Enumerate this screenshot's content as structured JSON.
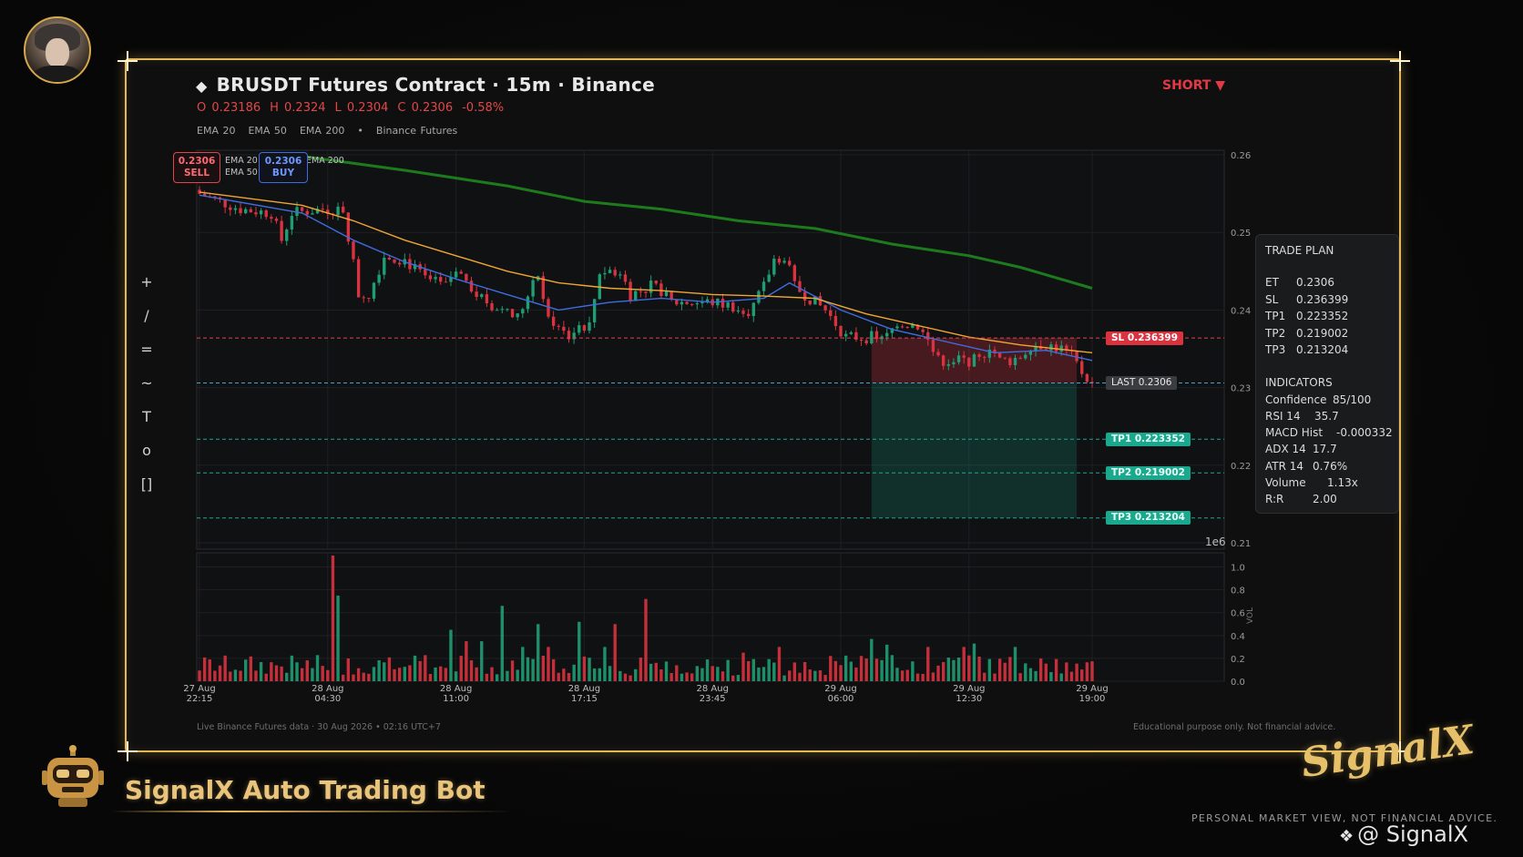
{
  "header": {
    "title": "BRUSDT Futures Contract  ·  15m  ·  Binance",
    "title_icon": "diamond-icon",
    "direction": "SHORT ▼",
    "ohlc": [
      "O 0.23186",
      "H 0.2324",
      "L 0.2304",
      "C 0.2306",
      "-0.58%"
    ],
    "indicator_row": [
      "EMA 20",
      "EMA 50",
      "EMA 200",
      "•",
      "Binance Futures"
    ]
  },
  "toolbar": {
    "tools": [
      "+",
      "/",
      "=",
      "~",
      "T",
      "o",
      "[]"
    ]
  },
  "quote": {
    "sell_price": "0.2306",
    "sell_label": "SELL",
    "buy_price": "0.2306",
    "buy_label": "BUY",
    "legend": [
      "EMA 20",
      "EMA 50",
      "EMA 200"
    ]
  },
  "levels": {
    "sl_tag": "SL  0.236399",
    "last_tag": "LAST  0.2306",
    "tp1_tag": "TP1  0.223352",
    "tp2_tag": "TP2  0.219002",
    "tp3_tag": "TP3  0.213204"
  },
  "trade_plan": {
    "title": "TRADE PLAN",
    "rows": [
      [
        "ET",
        "0.2306"
      ],
      [
        "SL",
        "0.236399"
      ],
      [
        "TP1",
        "0.223352"
      ],
      [
        "TP2",
        "0.219002"
      ],
      [
        "TP3",
        "0.213204"
      ]
    ],
    "indicators_title": "INDICATORS",
    "indicators": [
      [
        "Confidence",
        "85/100"
      ],
      [
        "RSI 14",
        "35.7"
      ],
      [
        "MACD Hist",
        "-0.000332"
      ],
      [
        "ADX 14",
        "17.7"
      ],
      [
        "ATR 14",
        "0.76%"
      ],
      [
        "Volume",
        "1.13x"
      ],
      [
        "R:R",
        "2.00"
      ]
    ]
  },
  "footer": {
    "left": "Live Binance Futures data  ·  30 Aug 2026 • 02:16 UTC+7",
    "right": "Educational purpose only. Not financial advice."
  },
  "branding": {
    "bot_name": "SignalX Auto Trading Bot",
    "logo_text": "SignalX",
    "disclaimer": "PERSONAL MARKET VIEW, NOT FINANCIAL ADVICE.",
    "handle": "@ SignalX",
    "handle_icon": "binance-diamond-icon"
  },
  "colors": {
    "frame": "#e3b85a",
    "up": "#1f9e73",
    "down": "#d8333f",
    "ema20": "#3d6de0",
    "ema50": "#f0a632",
    "ema200": "#1d7a1d",
    "sl_line": "#e0444f",
    "last_line": "#4aa0d8",
    "tp_line": "#1aa88e"
  },
  "chart_data": {
    "type": "candlestick",
    "price_axis": {
      "range": [
        0.21,
        0.26
      ],
      "ticks": [
        "0.26",
        "0.25",
        "0.24",
        "0.23",
        "0.22",
        "0.21"
      ],
      "multiplier_label": "1e6"
    },
    "volume_axis": {
      "label": "VOL",
      "range": [
        0,
        1.1
      ],
      "ticks": [
        "1.0",
        "0.8",
        "0.6",
        "0.4",
        "0.2",
        "0.0"
      ]
    },
    "x_ticks": [
      {
        "idx": 0,
        "l1": "27 Aug",
        "l2": "22:15"
      },
      {
        "idx": 25,
        "l1": "28 Aug",
        "l2": "04:30"
      },
      {
        "idx": 50,
        "l1": "28 Aug",
        "l2": "11:00"
      },
      {
        "idx": 75,
        "l1": "28 Aug",
        "l2": "17:15"
      },
      {
        "idx": 100,
        "l1": "28 Aug",
        "l2": "23:45"
      },
      {
        "idx": 125,
        "l1": "29 Aug",
        "l2": "06:00"
      },
      {
        "idx": 150,
        "l1": "29 Aug",
        "l2": "12:30"
      },
      {
        "idx": 174,
        "l1": "29 Aug",
        "l2": "19:00"
      }
    ],
    "candle_count": 175,
    "close_path": [
      [
        0,
        0.255
      ],
      [
        8,
        0.253
      ],
      [
        14,
        0.2525
      ],
      [
        16,
        0.249
      ],
      [
        18,
        0.2525
      ],
      [
        24,
        0.253
      ],
      [
        28,
        0.253
      ],
      [
        30,
        0.246
      ],
      [
        31,
        0.242
      ],
      [
        33,
        0.242
      ],
      [
        36,
        0.247
      ],
      [
        40,
        0.2465
      ],
      [
        44,
        0.244
      ],
      [
        48,
        0.243
      ],
      [
        50,
        0.2455
      ],
      [
        54,
        0.242
      ],
      [
        58,
        0.24
      ],
      [
        62,
        0.239
      ],
      [
        66,
        0.2445
      ],
      [
        68,
        0.2395
      ],
      [
        70,
        0.2375
      ],
      [
        72,
        0.2365
      ],
      [
        74,
        0.238
      ],
      [
        76,
        0.238
      ],
      [
        78,
        0.245
      ],
      [
        82,
        0.245
      ],
      [
        84,
        0.242
      ],
      [
        88,
        0.243
      ],
      [
        90,
        0.2425
      ],
      [
        92,
        0.241
      ],
      [
        96,
        0.241
      ],
      [
        100,
        0.241
      ],
      [
        104,
        0.2405
      ],
      [
        106,
        0.2395
      ],
      [
        108,
        0.2405
      ],
      [
        110,
        0.243
      ],
      [
        112,
        0.2465
      ],
      [
        114,
        0.247
      ],
      [
        116,
        0.243
      ],
      [
        118,
        0.242
      ],
      [
        122,
        0.24
      ],
      [
        126,
        0.2365
      ],
      [
        130,
        0.2365
      ],
      [
        134,
        0.2365
      ],
      [
        136,
        0.2385
      ],
      [
        140,
        0.238
      ],
      [
        142,
        0.236
      ],
      [
        144,
        0.2335
      ],
      [
        148,
        0.2335
      ],
      [
        152,
        0.2335
      ],
      [
        154,
        0.2355
      ],
      [
        156,
        0.2335
      ],
      [
        158,
        0.2335
      ],
      [
        160,
        0.234
      ],
      [
        162,
        0.2355
      ],
      [
        165,
        0.2355
      ],
      [
        168,
        0.235
      ],
      [
        170,
        0.234
      ],
      [
        172,
        0.232
      ],
      [
        174,
        0.2306
      ]
    ],
    "volume_spikes": [
      [
        26,
        1.1
      ],
      [
        27,
        0.75
      ],
      [
        49,
        0.45
      ],
      [
        52,
        0.35
      ],
      [
        55,
        0.35
      ],
      [
        59,
        0.66
      ],
      [
        63,
        0.3
      ],
      [
        66,
        0.5
      ],
      [
        68,
        0.3
      ],
      [
        74,
        0.52
      ],
      [
        79,
        0.3
      ],
      [
        81,
        0.5
      ],
      [
        87,
        0.72
      ],
      [
        106,
        0.25
      ],
      [
        113,
        0.3
      ],
      [
        131,
        0.37
      ],
      [
        134,
        0.32
      ],
      [
        142,
        0.3
      ],
      [
        149,
        0.3
      ],
      [
        151,
        0.33
      ],
      [
        159,
        0.3
      ]
    ],
    "ema_series": [
      {
        "name": "EMA 20",
        "points": [
          [
            0,
            0.2548
          ],
          [
            20,
            0.2525
          ],
          [
            30,
            0.249
          ],
          [
            40,
            0.2462
          ],
          [
            50,
            0.244
          ],
          [
            60,
            0.242
          ],
          [
            70,
            0.24
          ],
          [
            80,
            0.241
          ],
          [
            90,
            0.2415
          ],
          [
            100,
            0.241
          ],
          [
            110,
            0.2415
          ],
          [
            115,
            0.2435
          ],
          [
            125,
            0.24
          ],
          [
            135,
            0.2375
          ],
          [
            145,
            0.236
          ],
          [
            155,
            0.2345
          ],
          [
            165,
            0.2348
          ],
          [
            174,
            0.2335
          ]
        ]
      },
      {
        "name": "EMA 50",
        "points": [
          [
            0,
            0.2552
          ],
          [
            20,
            0.2535
          ],
          [
            30,
            0.2515
          ],
          [
            40,
            0.249
          ],
          [
            50,
            0.247
          ],
          [
            60,
            0.245
          ],
          [
            70,
            0.2435
          ],
          [
            80,
            0.2428
          ],
          [
            90,
            0.2425
          ],
          [
            100,
            0.242
          ],
          [
            110,
            0.2418
          ],
          [
            120,
            0.2415
          ],
          [
            130,
            0.2395
          ],
          [
            140,
            0.238
          ],
          [
            150,
            0.2365
          ],
          [
            160,
            0.2355
          ],
          [
            174,
            0.2345
          ]
        ]
      },
      {
        "name": "EMA 200",
        "points": [
          [
            18,
            0.26
          ],
          [
            40,
            0.258
          ],
          [
            60,
            0.256
          ],
          [
            75,
            0.254
          ],
          [
            90,
            0.253
          ],
          [
            105,
            0.2515
          ],
          [
            120,
            0.2505
          ],
          [
            135,
            0.2485
          ],
          [
            150,
            0.247
          ],
          [
            160,
            0.2455
          ],
          [
            174,
            0.2428
          ]
        ]
      }
    ],
    "levels": {
      "sl": 0.236399,
      "last": 0.2306,
      "tp1": 0.223352,
      "tp2": 0.219002,
      "tp3": 0.213204
    },
    "position_zone": {
      "start_idx": 131,
      "end_idx": 171
    }
  }
}
